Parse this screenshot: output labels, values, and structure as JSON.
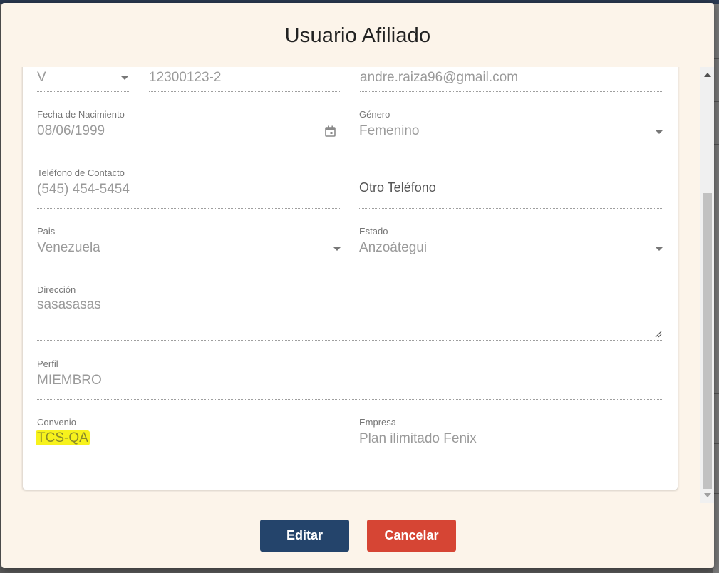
{
  "modal": {
    "title": "Usuario Afiliado"
  },
  "fields": {
    "doc_type": {
      "value": "V"
    },
    "doc_number": {
      "value": "12300123-2"
    },
    "email": {
      "value": "andre.raiza96@gmail.com"
    },
    "birth_date": {
      "label": "Fecha de Nacimiento",
      "value": "08/06/1999"
    },
    "gender": {
      "label": "Género",
      "value": "Femenino"
    },
    "contact_phone": {
      "label": "Teléfono de Contacto",
      "value": "(545) 454-5454"
    },
    "other_phone": {
      "placeholder": "Otro Teléfono"
    },
    "country": {
      "label": "Pais",
      "value": "Venezuela"
    },
    "state": {
      "label": "Estado",
      "value": "Anzoátegui"
    },
    "address": {
      "label": "Dirección",
      "value": "sasasasas"
    },
    "profile": {
      "label": "Perfil",
      "value": "MIEMBRO"
    },
    "agreement": {
      "label": "Convenio",
      "value": "TCS-QA"
    },
    "company": {
      "label": "Empresa",
      "value": "Plan ilimitado Fenix"
    }
  },
  "buttons": {
    "edit": "Editar",
    "cancel": "Cancelar"
  },
  "icons": {
    "calendar": "calendar-icon",
    "caret": "caret-down-icon",
    "resize": "resize-handle-icon"
  },
  "colors": {
    "edit_button": "#24446b",
    "cancel_button": "#d64534",
    "highlight": "#f7f21c",
    "modal_bg": "#fcf4ea"
  }
}
